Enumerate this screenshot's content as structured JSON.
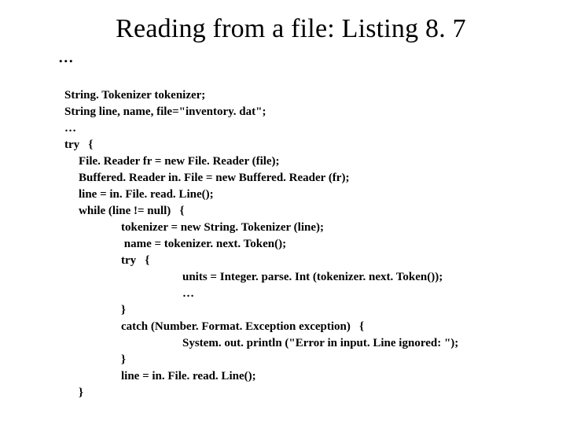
{
  "title": "Reading from a file: Listing 8. 7",
  "ellipsis": "...",
  "code": {
    "l01": "String. Tokenizer tokenizer;",
    "l02": "String line, name, file=\"inventory. dat\";",
    "l03": "…",
    "l04": "try   {",
    "l05": "File. Reader fr = new File. Reader (file);",
    "l06": "Buffered. Reader in. File = new Buffered. Reader (fr);",
    "l07": "line = in. File. read. Line();",
    "l08": "while (line != null)   {",
    "l09": "tokenizer = new String. Tokenizer (line);",
    "l10": " name = tokenizer. next. Token();",
    "l11": "try   {",
    "l12": "units = Integer. parse. Int (tokenizer. next. Token());",
    "l13": "…",
    "l14": "}",
    "l15": "catch (Number. Format. Exception exception)   {",
    "l16": "System. out. println (\"Error in input. Line ignored: \");",
    "l17": "}",
    "l18": "line = in. File. read. Line();",
    "l19": "}"
  }
}
